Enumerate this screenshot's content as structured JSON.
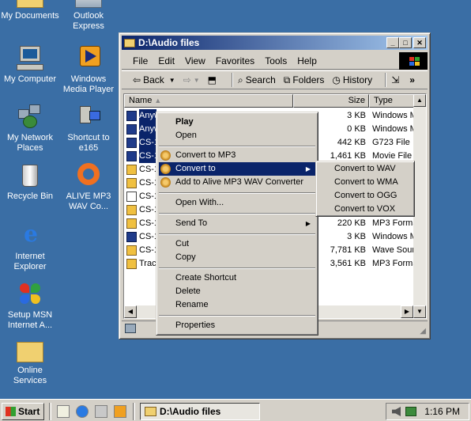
{
  "desktop_icons": [
    {
      "label": "My Documents"
    },
    {
      "label": "Outlook Express"
    },
    {
      "label": "My Computer"
    },
    {
      "label": "Windows Media Player"
    },
    {
      "label": "My Network Places"
    },
    {
      "label": "Shortcut to e165"
    },
    {
      "label": "Recycle Bin"
    },
    {
      "label": "ALIVE MP3 WAV Co..."
    },
    {
      "label": "Internet Explorer"
    },
    {
      "label": "Setup MSN Internet A..."
    },
    {
      "label": "Online Services"
    }
  ],
  "window": {
    "title": "D:\\Audio files",
    "menu": [
      "File",
      "Edit",
      "View",
      "Favorites",
      "Tools",
      "Help"
    ],
    "toolbar": {
      "back": "Back",
      "search": "Search",
      "folders": "Folders",
      "history": "History"
    },
    "columns": {
      "name": "Name",
      "size": "Size",
      "type": "Type"
    },
    "files": [
      {
        "name": "Anyw",
        "size": "3 KB",
        "type": "Windows Med",
        "selected": true
      },
      {
        "name": "Anyw",
        "size": "0 KB",
        "type": "Windows Med",
        "selected": true
      },
      {
        "name": "CS-1",
        "size": "442 KB",
        "type": "G723 File",
        "selected": true
      },
      {
        "name": "CS-1",
        "size": "1,461 KB",
        "type": "Movie File (MP",
        "selected": true
      },
      {
        "name": "CS-1",
        "size": "",
        "type": "MP3 Format S",
        "selected": false
      },
      {
        "name": "CS-1",
        "size": "",
        "type": "",
        "selected": false
      },
      {
        "name": "CS-1",
        "size": "",
        "type": "",
        "selected": false
      },
      {
        "name": "CS-1",
        "size": "",
        "type": "und",
        "selected": false
      },
      {
        "name": "CS-1",
        "size": "220 KB",
        "type": "MP3 Format S",
        "selected": false
      },
      {
        "name": "CS-1",
        "size": "3 KB",
        "type": "Windows Med",
        "selected": false
      },
      {
        "name": "CS-1",
        "size": "7,781 KB",
        "type": "Wave Sound",
        "selected": false
      },
      {
        "name": "Trac",
        "size": "3,561 KB",
        "type": "MP3 Format S",
        "selected": false
      }
    ]
  },
  "context_menu": {
    "items": [
      {
        "label": "Play",
        "bold": true
      },
      {
        "label": "Open"
      },
      {
        "label": "Convert to MP3"
      },
      {
        "label": "Convert to",
        "highlighted": true
      },
      {
        "label": "Add to Alive MP3 WAV Converter"
      },
      {
        "label": "Open With..."
      },
      {
        "label": "Send To"
      },
      {
        "label": "Cut"
      },
      {
        "label": "Copy"
      },
      {
        "label": "Create Shortcut"
      },
      {
        "label": "Delete"
      },
      {
        "label": "Rename"
      },
      {
        "label": "Properties"
      }
    ]
  },
  "submenu": {
    "items": [
      "Convert to WAV",
      "Convert to WMA",
      "Convert to OGG",
      "Convert to VOX"
    ]
  },
  "taskbar": {
    "start": "Start",
    "task": "D:\\Audio files",
    "time": "1:16 PM"
  },
  "colors": {
    "desktop": "#3a6ea5",
    "highlight": "#0a246a",
    "face": "#d4d0c8"
  }
}
